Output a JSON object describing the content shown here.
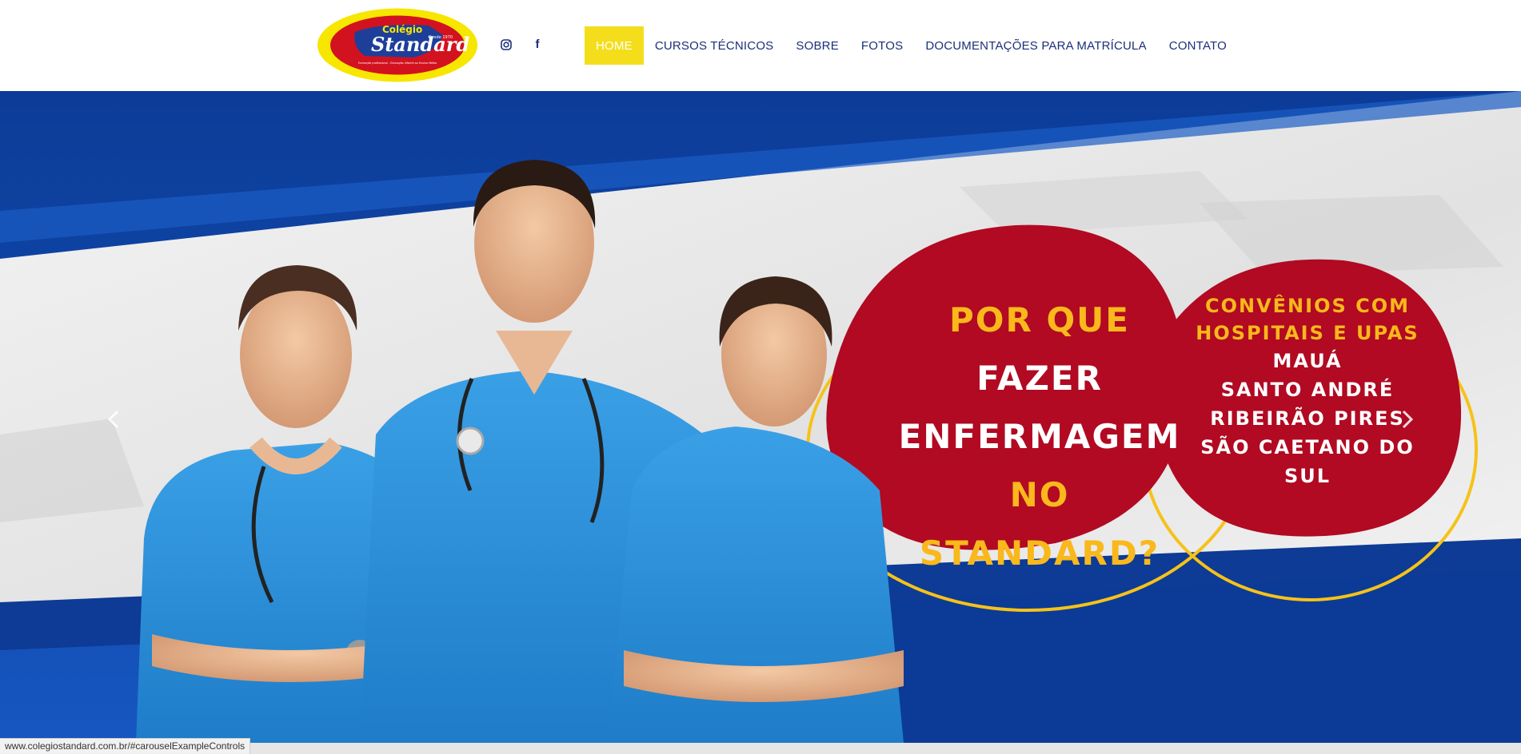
{
  "header": {
    "logo": {
      "brand_word": "Standard",
      "top_word": "Colégio",
      "badge_text": "Desde 1970",
      "small_print": "Formação profissional - Educação Infantil ao Ensino Médio"
    },
    "social": [
      {
        "name": "instagram-icon"
      },
      {
        "name": "facebook-icon",
        "glyph": "f"
      }
    ],
    "nav": [
      {
        "label": "HOME",
        "active": true
      },
      {
        "label": "CURSOS TÉCNICOS",
        "active": false
      },
      {
        "label": "SOBRE",
        "active": false
      },
      {
        "label": "FOTOS",
        "active": false
      },
      {
        "label": "DOCUMENTAÇÕES PARA MATRÍCULA",
        "active": false
      },
      {
        "label": "CONTATO",
        "active": false
      }
    ]
  },
  "hero": {
    "headline": {
      "line1_yellow": "POR QUE",
      "line1_white": "FAZER",
      "line2": "ENFERMAGEM",
      "line3": "NO STANDARD?"
    },
    "side": {
      "title_line1": "CONVÊNIOS COM",
      "title_line2": "HOSPITAIS E UPAS",
      "cities": [
        "MAUÁ",
        "SANTO ANDRÉ",
        "RIBEIRÃO PIRES",
        "SÃO CAETANO DO SUL"
      ]
    },
    "controls": {
      "prev_icon": "chevron-left-icon",
      "next_icon": "chevron-right-icon"
    }
  },
  "status_bar": {
    "url": "www.colegiostandard.com.br/#carouselExampleControls"
  },
  "colors": {
    "nav_text": "#1c2f78",
    "active_bg": "#f4de1c",
    "bubble_red": "#b10a22",
    "bubble_yellow": "#f9b81b",
    "ring": "#f6c21a",
    "blue": "#0f45a8",
    "scrub": "#2a8fd8"
  }
}
